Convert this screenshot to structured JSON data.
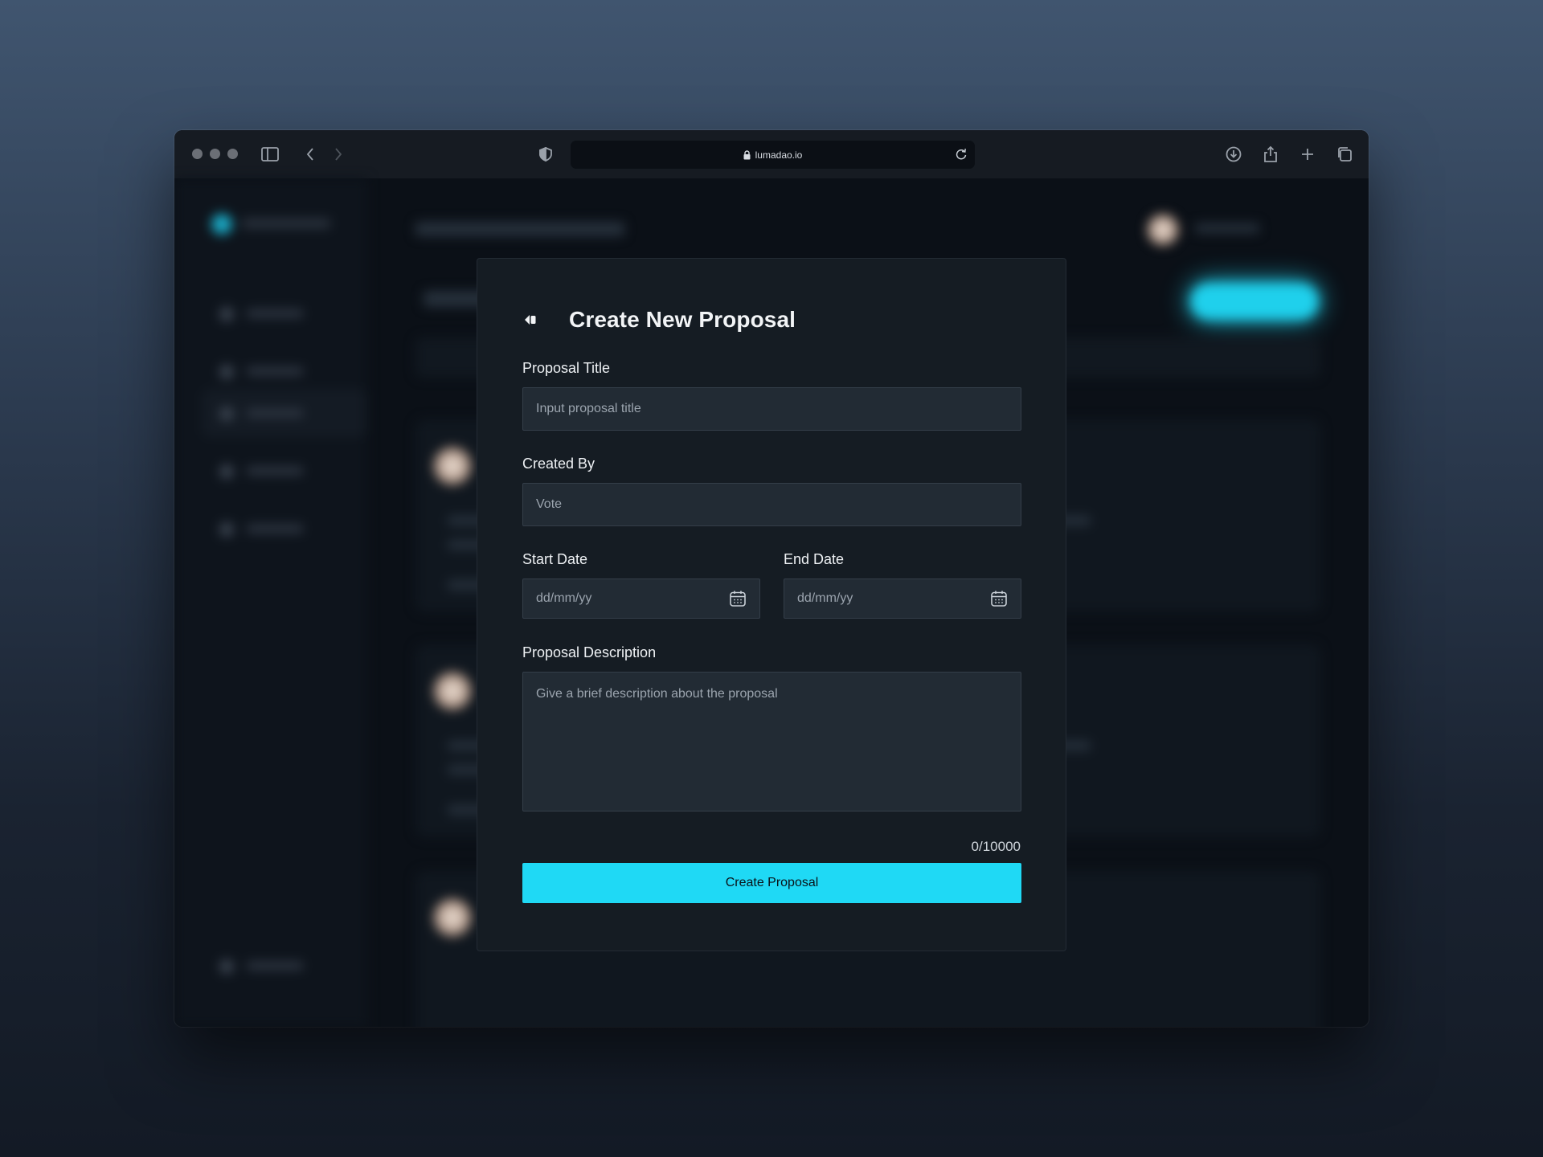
{
  "browser": {
    "url": "lumadao.io"
  },
  "modal": {
    "title": "Create New Proposal",
    "proposal_title": {
      "label": "Proposal Title",
      "placeholder": "Input proposal title"
    },
    "created_by": {
      "label": "Created By",
      "value": "Vote"
    },
    "start_date": {
      "label": "Start Date",
      "placeholder": "dd/mm/yy"
    },
    "end_date": {
      "label": "End Date",
      "placeholder": "dd/mm/yy"
    },
    "description": {
      "label": "Proposal Description",
      "placeholder": "Give a brief description about the proposal",
      "counter": "0/10000"
    },
    "submit_label": "Create Proposal"
  },
  "colors": {
    "accent": "#1fd9f5",
    "modal_bg": "#151c23",
    "field_bg": "#222b34"
  },
  "icons": {
    "back": "back-arrow-icon",
    "calendar": "calendar-icon",
    "lock": "lock-icon",
    "reload": "reload-icon"
  }
}
